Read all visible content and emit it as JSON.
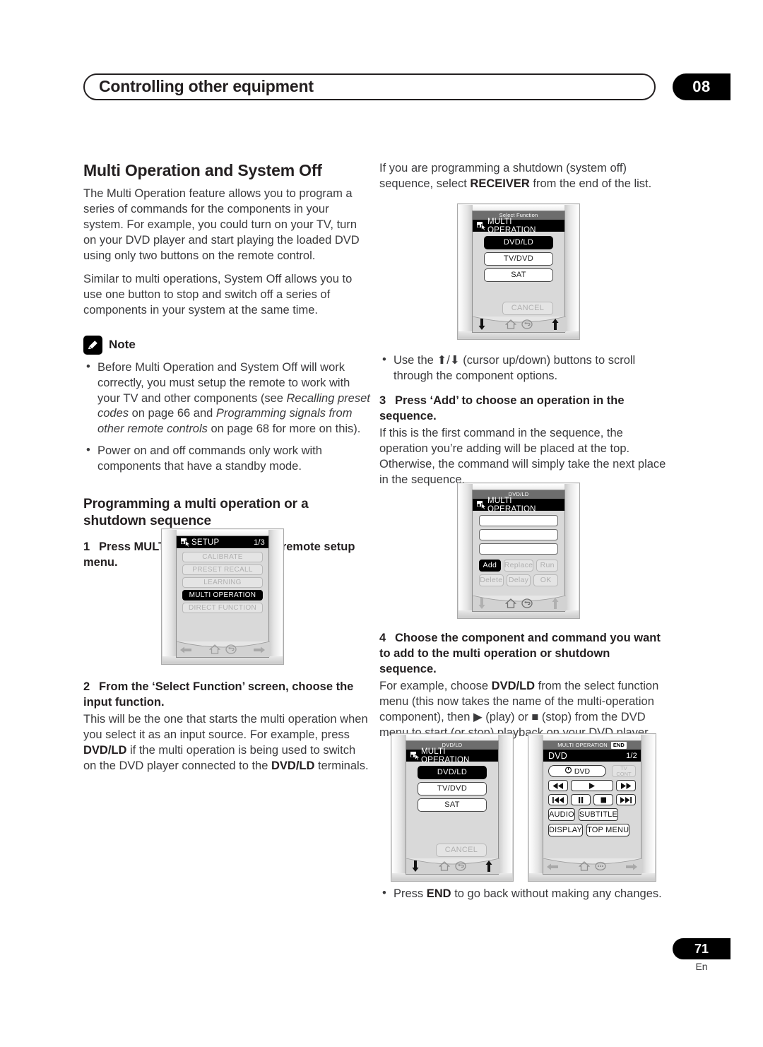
{
  "header": {
    "title": "Controlling other equipment",
    "chapter": "08"
  },
  "footer": {
    "page_number": "71",
    "language": "En"
  },
  "left_column": {
    "section_title": "Multi Operation and System Off",
    "para1": "The Multi Operation feature allows you to program a series of commands for the components in your system. For example, you could turn on your TV, turn on your DVD player and start playing the loaded DVD using only two buttons on the remote control.",
    "para2": "Similar to multi operations, System Off allows you to use one button to stop and switch off a series of components in your system at the same time.",
    "note_label": "Note",
    "note_bullets": [
      "Before Multi Operation and System Off will work correctly, you must setup the remote to work with your TV and other components (see <i>Recalling preset codes</i> on page 66 and <i>Programming signals from other remote controls</i> on page 68 for more on this).",
      "Power on and off commands only work with components that have a standby mode."
    ],
    "sub_title": "Programming a multi operation or a shutdown sequence",
    "step1_num": "1",
    "step1_text": "Press MULTI OPERATION on the remote setup menu.",
    "step2_num": "2",
    "step2_text": "From the ‘Select Function’ screen, choose the input function.",
    "step2_body": "This will be the one that starts the multi operation when you select it as an input source. For example, press <b>DVD/LD</b> if the multi operation is being used to switch on the DVD player connected to the <b>DVD/LD</b> terminals."
  },
  "right_column": {
    "intro": "If you are programming a shutdown (system off) sequence, select <b>RECEIVER</b> from the end of the list.",
    "bullet_scroll": "Use the ⬆/⬇ (cursor up/down) buttons to scroll through the component options.",
    "step3_num": "3",
    "step3_text": "Press ‘Add’ to choose an operation in the sequence.",
    "step3_body": "If this is the first command in the sequence, the operation you’re adding will be placed at the top. Otherwise, the command will simply take the next place in the sequence.",
    "step4_num": "4",
    "step4_text": "Choose the component and command you want to add to the multi operation or shutdown sequence.",
    "step4_body": "For example, choose <b>DVD/LD</b> from the select function menu (this now takes the name of the multi-operation component), then ▶ (play) or ■ (stop) from the DVD menu to start (or stop) playback on your DVD player.",
    "bullet_end": "Press <b>END</b> to go back without making any changes."
  },
  "figures": {
    "setup_menu": {
      "title": "SETUP",
      "page_indicator": "1/3",
      "items": [
        {
          "label": "CALIBRATE",
          "state": "dim"
        },
        {
          "label": "PRESET RECALL",
          "state": "dim"
        },
        {
          "label": "LEARNING",
          "state": "dim"
        },
        {
          "label": "MULTI OPERATION",
          "state": "selected"
        },
        {
          "label": "DIRECT FUNCTION",
          "state": "dim"
        }
      ],
      "nav": [
        "left-arrow-icon",
        "home-icon",
        "return-icon",
        "right-arrow-icon"
      ]
    },
    "select_function": {
      "subtitle": "Select Function",
      "title": "MULTI OPERATION",
      "items": [
        {
          "label": "DVD/LD",
          "state": "selected"
        },
        {
          "label": "TV/DVD",
          "state": "white"
        },
        {
          "label": "SAT",
          "state": "white"
        }
      ],
      "cancel_label": "CANCEL",
      "nav": [
        "down-arrow-icon",
        "home-icon",
        "return-icon",
        "up-arrow-icon"
      ]
    },
    "multi_op_edit": {
      "subtitle": "DVD/LD",
      "title": "MULTI OPERATION",
      "slots": [
        "",
        "",
        ""
      ],
      "buttons_row1": [
        {
          "label": "Add",
          "state": "selected"
        },
        {
          "label": "Replace",
          "state": "dim"
        },
        {
          "label": "Run",
          "state": "dim"
        }
      ],
      "buttons_row2": [
        {
          "label": "Delete",
          "state": "dim"
        },
        {
          "label": "Delay",
          "state": "dim"
        },
        {
          "label": "OK",
          "state": "dim"
        }
      ],
      "nav": [
        "down-arrow-icon",
        "home-icon",
        "return-icon",
        "up-arrow-icon"
      ]
    },
    "select_function2": {
      "subtitle": "DVD/LD",
      "title": "MULTI OPERATION",
      "items": [
        {
          "label": "DVD/LD",
          "state": "selected"
        },
        {
          "label": "TV/DVD",
          "state": "white"
        },
        {
          "label": "SAT",
          "state": "white"
        }
      ],
      "cancel_label": "CANCEL",
      "nav": [
        "down-arrow-icon",
        "home-icon",
        "return-icon",
        "up-arrow-icon"
      ]
    },
    "dvd_control": {
      "subtitle": "MULTI OPERATION",
      "end_badge": "END",
      "title": "DVD",
      "page_indicator": "1/2",
      "power_label": "DVD",
      "tv_cont_line1": "TV",
      "tv_cont_line2": "CONT",
      "transport_row1": [
        "rewind-icon",
        "play-icon",
        "fast-forward-icon"
      ],
      "transport_row2": [
        "previous-icon",
        "pause-icon",
        "stop-icon",
        "next-icon"
      ],
      "buttons": [
        "AUDIO",
        "SUBTITLE",
        "DISPLAY",
        "TOP MENU"
      ],
      "nav": [
        "left-arrow-icon",
        "home-icon",
        "keypad-icon",
        "right-arrow-icon"
      ]
    }
  }
}
